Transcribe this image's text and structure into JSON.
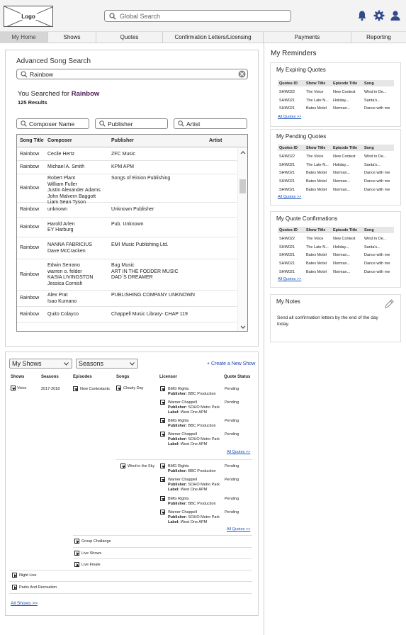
{
  "header": {
    "logo": "Logo",
    "search_placeholder": "Global Search"
  },
  "nav": [
    "My Home",
    "Shows",
    "Quotes",
    "Confirmation Letters/Licensing",
    "Payments",
    "Reporting"
  ],
  "advanced_search": {
    "title": "Advanced Song Search",
    "query": "Rainbow",
    "you_searched_prefix": "You Searched for",
    "term": "Rainbow",
    "results": "125 Results",
    "filters": [
      "Composer Name",
      "Publisher",
      "Artist"
    ],
    "columns": [
      "Song Title",
      "Composer",
      "Publisher",
      "Artist"
    ],
    "rows": [
      {
        "title": "Rainbow",
        "composer": "Cecile Hertz",
        "publisher": "ZFC Music",
        "artist": ""
      },
      {
        "title": "Rainbow",
        "composer": "Michael A. Smith",
        "publisher": "KPM APM",
        "artist": ""
      },
      {
        "title": "Rainbow",
        "composer": "Robert Plant\nWilliam Fuller\nJustin Alexander Adams\nJohn Malvern Baggott\nLiam Sean Tyson",
        "publisher": "Songs of Einion Publishing",
        "artist": ""
      },
      {
        "title": "Rainbow",
        "composer": "unknown",
        "publisher": "Unknown Publisher",
        "artist": ""
      },
      {
        "title": "Rainbow",
        "composer": "Harold Arlen\nEY Harburg",
        "publisher": "Pub. Unknown",
        "artist": ""
      },
      {
        "title": "Rainbow",
        "composer": "NANNA FABRICIUS\nDave McCracken",
        "publisher": "EMI Music Publishing Ltd.",
        "artist": ""
      },
      {
        "title": "Rainbow",
        "composer": "Edwin Serrano\nwarren o. felder\nKASIA LIVINGSTON\nJessica Cornish",
        "publisher": "Bug Music\nART IN THE FODDER MUSIC\nDAD´S DREAMER",
        "artist": ""
      },
      {
        "title": "Rainbow",
        "composer": "Alex Prat\nIsao Kumano",
        "publisher": "PUBLISHING COMPANY UNKNOWN",
        "artist": ""
      },
      {
        "title": "Rainbow",
        "composer": "Quito Colayco",
        "publisher": "Chappell Music Library- CHAP 119",
        "artist": ""
      }
    ]
  },
  "reminders": {
    "title": "My Reminders",
    "columns": [
      "Quotes ID",
      "Show Title",
      "Episode Title",
      "Song"
    ],
    "all_quotes": "All Quotes >>",
    "expiring": {
      "title": "My Expiring Quotes",
      "rows": [
        [
          "SHW022",
          "The Voice",
          "New Contest",
          "Wind in De..."
        ],
        [
          "SHW021",
          "The Late N...",
          "Holiday...",
          "Santa's..."
        ],
        [
          "SHW021",
          "Bates Motel",
          "Norman...",
          "Dance with me"
        ]
      ]
    },
    "pending": {
      "title": "My Pending Quotes",
      "rows": [
        [
          "SHW022",
          "The Voice",
          "New Contest",
          "Wind in De..."
        ],
        [
          "SHW021",
          "The Late N...",
          "Holiday...",
          "Santa's..."
        ],
        [
          "SHW021",
          "Bates Motel",
          "Norman...",
          "Dance with me"
        ],
        [
          "SHW021",
          "Bates Motel",
          "Norman...",
          "Dance with me"
        ],
        [
          "SHW021",
          "Bates Motel",
          "Norman...",
          "Dance with me"
        ]
      ]
    },
    "confirmations": {
      "title": "My Quote Confirmations",
      "rows": [
        [
          "SHW022",
          "The Voice",
          "New Contest",
          "Wind in De..."
        ],
        [
          "SHW021",
          "The Late N...",
          "Holiday...",
          "Santa's..."
        ],
        [
          "SHW021",
          "Bates Motel",
          "Norman...",
          "Dance with me"
        ],
        [
          "SHW021",
          "Bates Motel",
          "Norman...",
          "Dance with me"
        ],
        [
          "SHW021",
          "Bates Motel",
          "Norman...",
          "Dance with me"
        ]
      ]
    },
    "notes": {
      "title": "My Notes",
      "text": "Send all confirmation letters by the end of the day today."
    }
  },
  "my_shows": {
    "shows_select": "My Shows",
    "seasons_select": "Seasons",
    "create": "+ Create a New Show",
    "columns": [
      "Shows",
      "Seasons",
      "Episodes",
      "Songs",
      "Licensor",
      "Quote Status"
    ],
    "show_voice": "Voice",
    "season": "2017-2018",
    "episode_1": "New Contestants",
    "song_1": "Cloudy Day",
    "song_2": "Wind in the Sky",
    "bmg": "BMG Rights",
    "warner": "Warner Chappell",
    "publisher_label": "Publisher:",
    "label_label": "Label:",
    "bbc": "BBC Production",
    "soho": "SOHO Metro Park",
    "west_one": "West One APM",
    "pending": "Pending",
    "all_quotes": "All Quotes >>",
    "episode_2": "Group Challange",
    "episode_3": "Live Shows",
    "episode_4": "Live Finale",
    "show_2": "Night Live",
    "show_3": "Parks And Recreation",
    "all_shows": "All Shows >>"
  }
}
